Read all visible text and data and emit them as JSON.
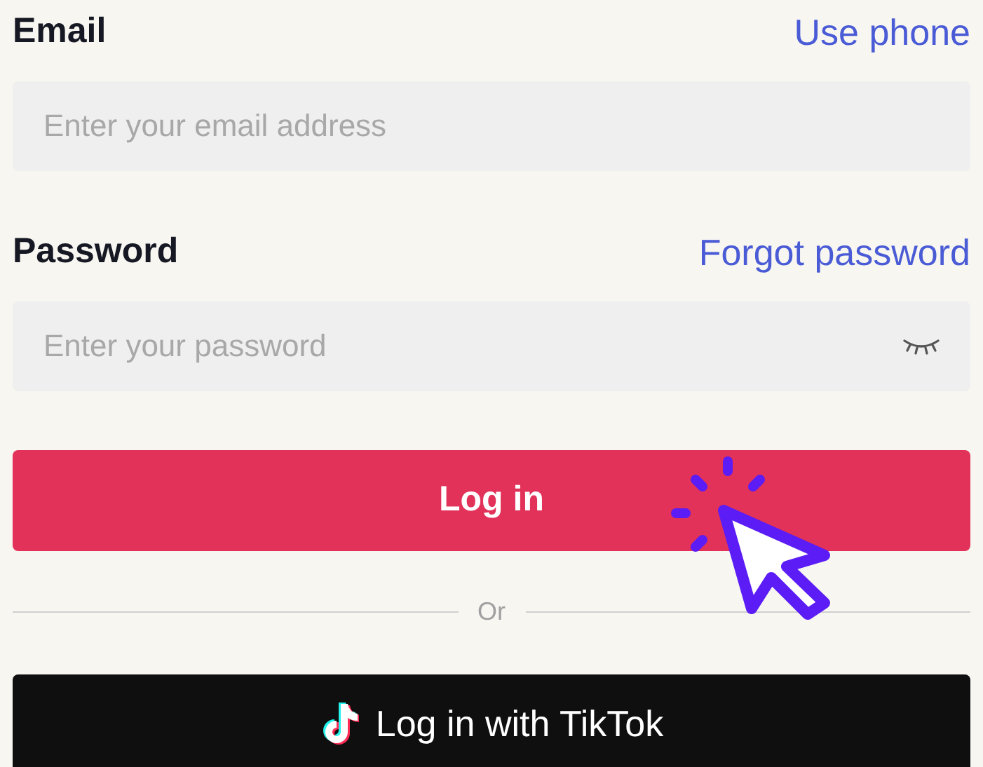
{
  "email": {
    "label": "Email",
    "link": "Use phone",
    "placeholder": "Enter your email address"
  },
  "password": {
    "label": "Password",
    "link": "Forgot password",
    "placeholder": "Enter your password"
  },
  "login_button": "Log in",
  "divider": "Or",
  "tiktok_button": "Log in with TikTok"
}
